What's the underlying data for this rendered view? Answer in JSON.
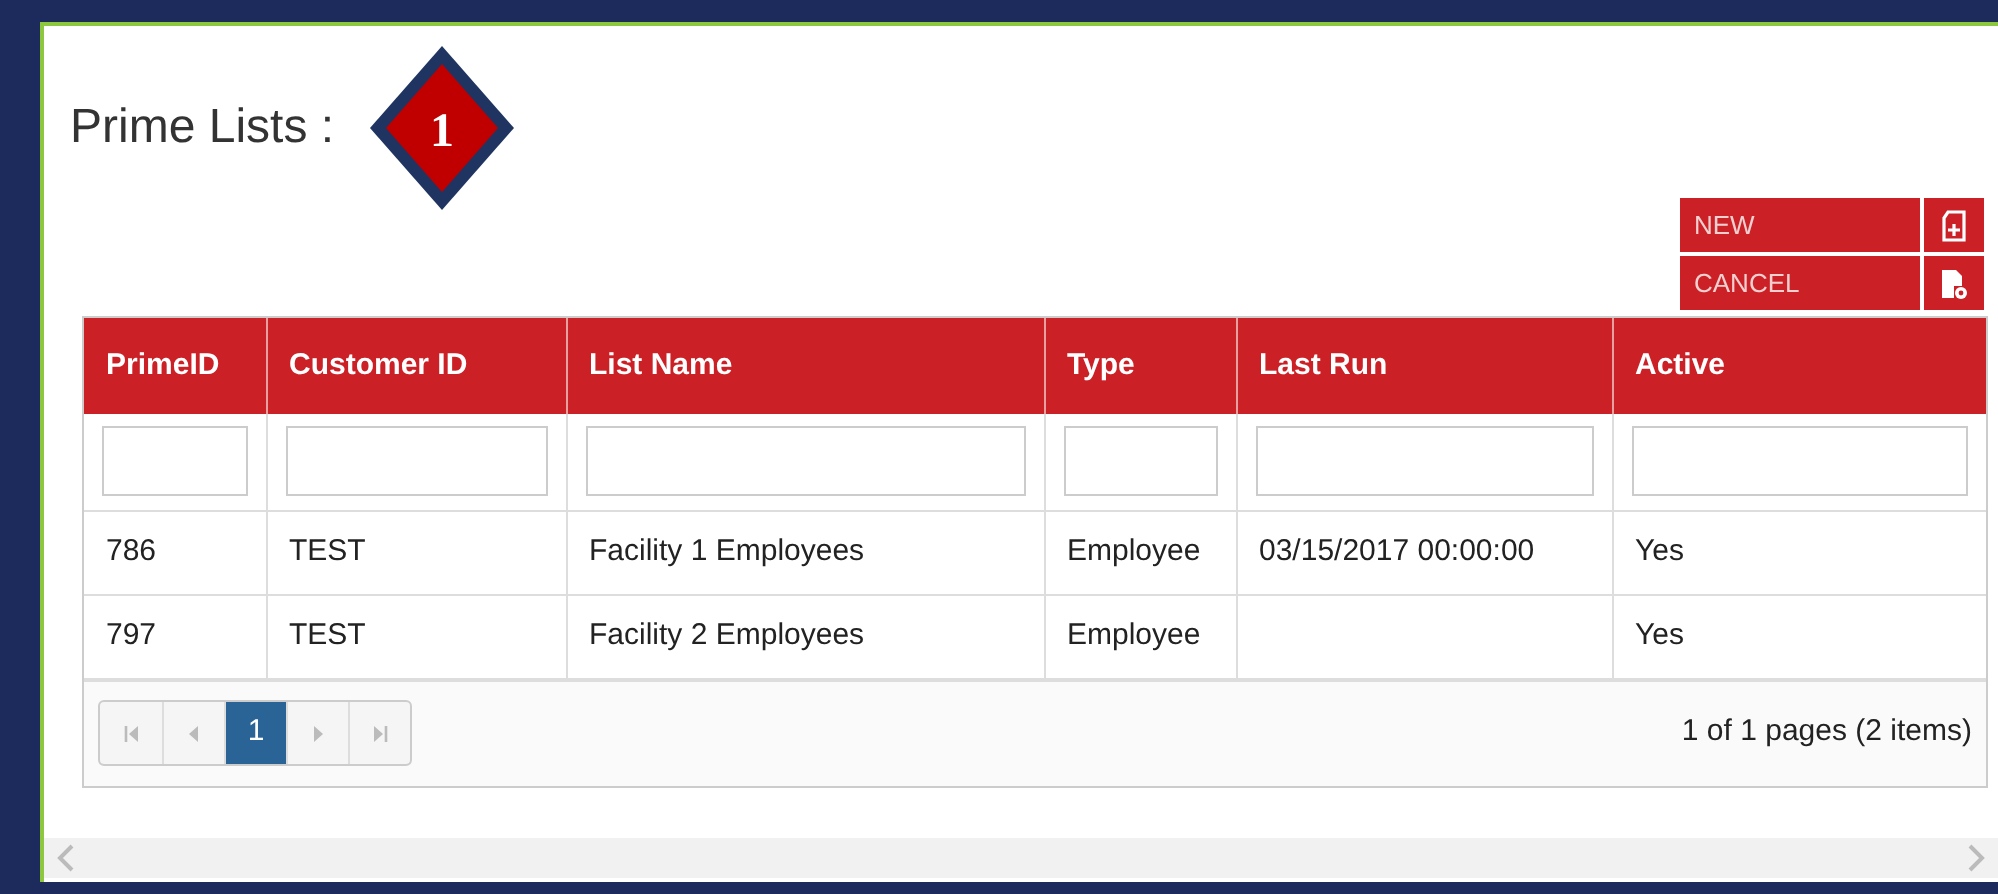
{
  "title": "Prime Lists :",
  "step_badge": "1",
  "actions": [
    {
      "label": "NEW",
      "kind": "new"
    },
    {
      "label": "CANCEL",
      "kind": "cancel"
    }
  ],
  "table": {
    "columns": [
      "PrimeID",
      "Customer ID",
      "List Name",
      "Type",
      "Last Run",
      "Active"
    ],
    "rows": [
      [
        "786",
        "TEST",
        "Facility 1 Employees",
        "Employee",
        "03/15/2017 00:00:00",
        "Yes"
      ],
      [
        "797",
        "TEST",
        "Facility 2 Employees",
        "Employee",
        "",
        "Yes"
      ]
    ]
  },
  "pager": {
    "buttons": [
      {
        "kind": "first",
        "disabled": true
      },
      {
        "kind": "prev",
        "disabled": true
      },
      {
        "kind": "page",
        "label": "1",
        "selected": true
      },
      {
        "kind": "next",
        "disabled": true
      },
      {
        "kind": "last",
        "disabled": true
      }
    ],
    "summary": "1 of 1 pages (2 items)"
  }
}
